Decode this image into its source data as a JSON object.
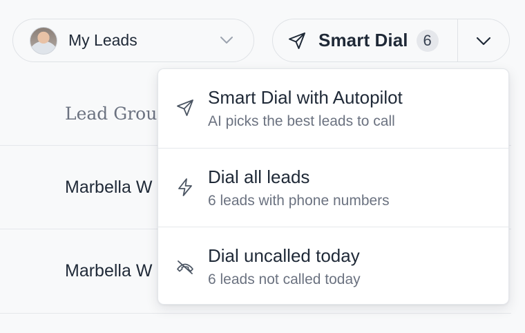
{
  "owner_select": {
    "label": "My Leads",
    "avatar": "user-avatar",
    "chevron_icon": "chevron-down-icon"
  },
  "smart_dial": {
    "label": "Smart Dial",
    "count": "6",
    "icon": "send-icon",
    "toggle_icon": "chevron-down-icon"
  },
  "table": {
    "column_header": "Lead Grou",
    "rows": [
      {
        "name": "Marbella W"
      },
      {
        "name": "Marbella W"
      }
    ]
  },
  "menu": {
    "items": [
      {
        "title": "Smart Dial with Autopilot",
        "subtitle": "AI picks the best leads to call",
        "icon": "send-icon"
      },
      {
        "title": "Dial all leads",
        "subtitle": "6 leads with phone numbers",
        "icon": "lightning-icon"
      },
      {
        "title": "Dial uncalled today",
        "subtitle": "6 leads not called today",
        "icon": "phone-off-icon"
      }
    ]
  },
  "colors": {
    "background": "#f8f9fa",
    "text": "#1f2937",
    "muted": "#6b7280",
    "border": "#e5e7eb"
  }
}
